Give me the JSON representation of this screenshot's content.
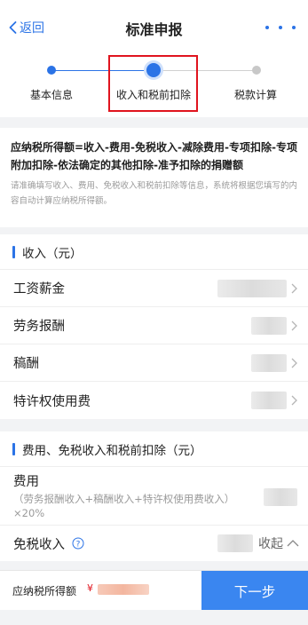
{
  "nav": {
    "back_label": "返回",
    "title": "标准申报"
  },
  "stepper": {
    "steps": [
      {
        "label": "基本信息",
        "state": "done"
      },
      {
        "label": "收入和税前扣除",
        "state": "current"
      },
      {
        "label": "税款计算",
        "state": "pending"
      }
    ]
  },
  "formula": {
    "text": "应纳税所得额=收入-费用-免税收入-减除费用-专项扣除-专项附加扣除-依法确定的其他扣除-准予扣除的捐赠额",
    "hint": "请准确填写收入、费用、免税收入和税前扣除等信息，系统将根据您填写的内容自动计算应纳税所得额。"
  },
  "income": {
    "title": "收入（元）",
    "rows": [
      {
        "label": "工资薪金"
      },
      {
        "label": "劳务报酬"
      },
      {
        "label": "稿酬"
      },
      {
        "label": "特许权使用费"
      }
    ]
  },
  "deductions": {
    "title": "费用、免税收入和税前扣除（元）",
    "expense_title": "费用",
    "expense_sub": "（劳务报酬收入+稿酬收入+特许权使用费收入）×20%",
    "taxfree_label": "免税收入",
    "collapse_label": "收起"
  },
  "bottom": {
    "taxable_label": "应纳税所得额",
    "currency_symbol": "¥",
    "next_button": "下一步"
  },
  "colors": {
    "accent": "#2b73e6",
    "button": "#3a86f0",
    "highlight": "#e0141e"
  }
}
